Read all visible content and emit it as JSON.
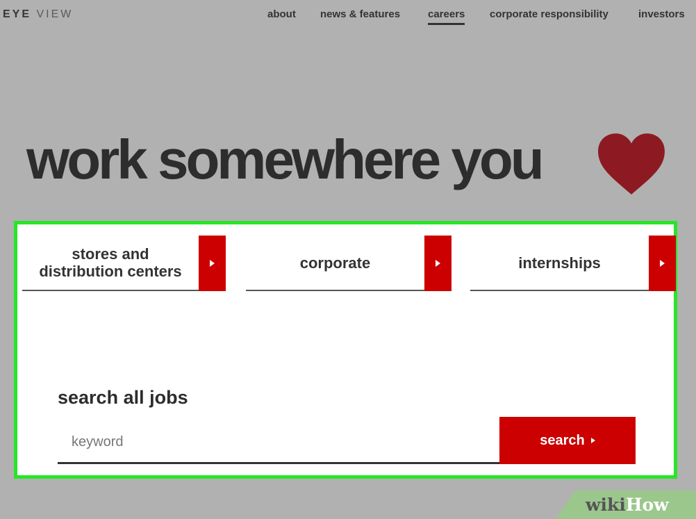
{
  "brand": {
    "part1": "EYE",
    "part2": "VIEW"
  },
  "nav": {
    "items": [
      {
        "label": "about",
        "active": false
      },
      {
        "label": "news & features",
        "active": false
      },
      {
        "label": "careers",
        "active": true
      },
      {
        "label": "corporate responsibility",
        "active": false
      },
      {
        "label": "investors",
        "active": false
      }
    ]
  },
  "hero": {
    "text": "work somewhere you",
    "icon": "heart-icon"
  },
  "categories": [
    {
      "line1": "stores and",
      "line2": "distribution centers",
      "icon": "arrow-right-icon"
    },
    {
      "line1": "corporate",
      "line2": "",
      "icon": "arrow-right-icon"
    },
    {
      "line1": "internships",
      "line2": "",
      "icon": "arrow-right-icon"
    }
  ],
  "search": {
    "title": "search all jobs",
    "keyword_placeholder": "keyword",
    "keyword_value": "",
    "button_label": "search"
  },
  "watermark": {
    "part1": "wiki",
    "part2": "How"
  },
  "colors": {
    "accent": "#cc0000",
    "highlight_border": "#27e627",
    "heart": "#8d1a22",
    "page_background": "#b1b1b1"
  }
}
